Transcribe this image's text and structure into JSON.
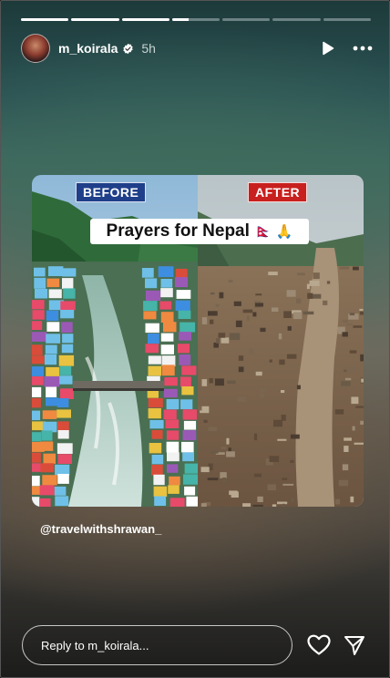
{
  "story": {
    "progress": [
      1,
      1,
      1,
      0.35,
      0,
      0,
      0
    ],
    "username": "m_koirala",
    "time_ago": "5h",
    "caption": "@travelwithshrawan_"
  },
  "image": {
    "before_label": "BEFORE",
    "after_label": "AFTER",
    "banner_text": "Prayers for Nepal",
    "banner_emoji": "🇳🇵 🙏"
  },
  "reply": {
    "placeholder": "Reply to m_koirala..."
  },
  "icons": {
    "play": "play-icon",
    "more": "more-icon",
    "like": "heart-icon",
    "share": "send-icon",
    "verified": "verified-badge-icon"
  },
  "colors": {
    "before_tag": "#1f3f8a",
    "after_tag": "#c8201e"
  }
}
